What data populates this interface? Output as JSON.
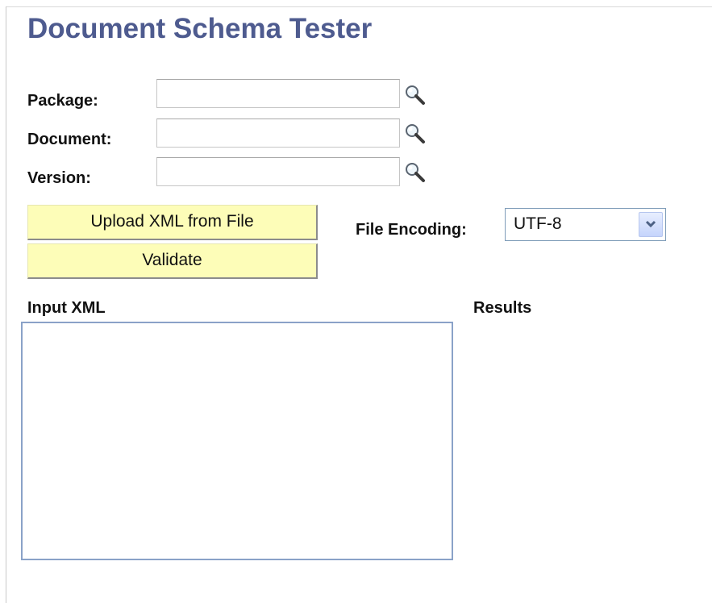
{
  "header": {
    "title": "Document Schema Tester"
  },
  "fields": {
    "package": {
      "label": "Package:",
      "value": "",
      "lookup_icon": "magnifier-icon"
    },
    "document": {
      "label": "Document:",
      "value": "",
      "lookup_icon": "magnifier-icon"
    },
    "version": {
      "label": "Version:",
      "value": "",
      "lookup_icon": "magnifier-icon"
    }
  },
  "actions": {
    "upload_label": "Upload XML from File",
    "validate_label": "Validate"
  },
  "encoding": {
    "label": "File Encoding:",
    "selected": "UTF-8",
    "arrow_icon": "chevron-down-icon"
  },
  "input_xml": {
    "label": "Input XML",
    "value": ""
  },
  "results": {
    "label": "Results"
  },
  "colors": {
    "title": "#4e5b8f",
    "button_bg": "#fdfdb8",
    "input_border": "#8aa2c8"
  }
}
